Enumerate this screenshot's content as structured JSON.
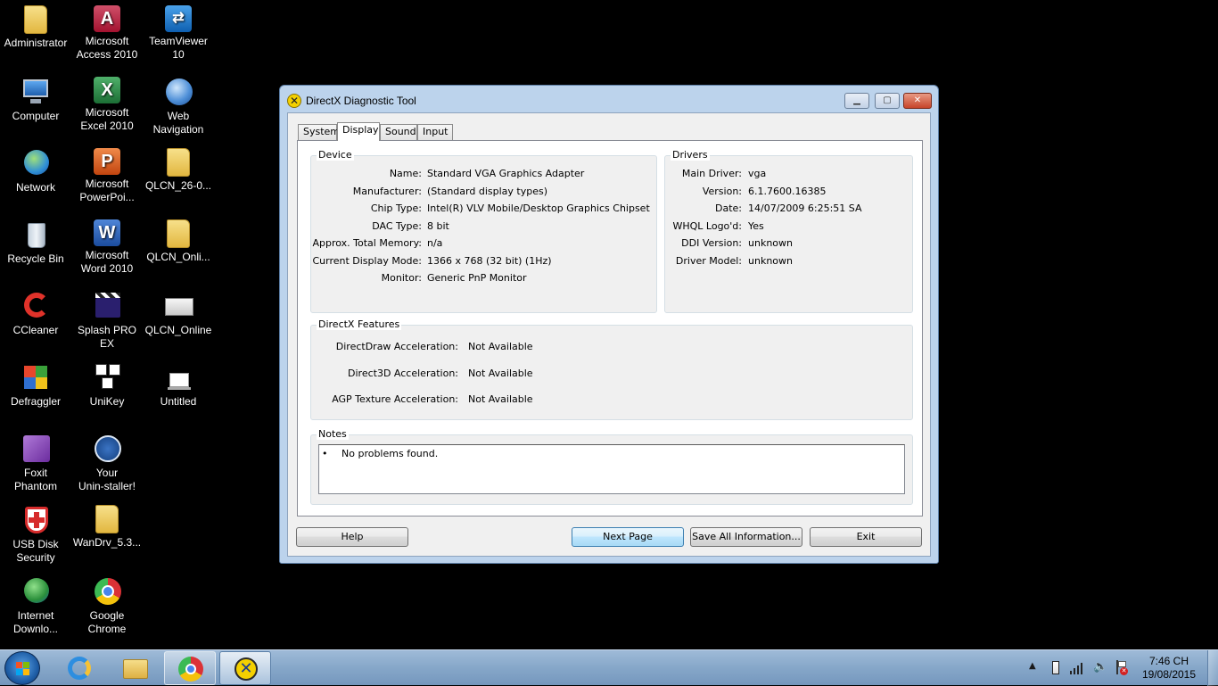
{
  "desktop_icons": [
    {
      "label": "Administrator"
    },
    {
      "label": "Computer"
    },
    {
      "label": "Network"
    },
    {
      "label": "Recycle Bin"
    },
    {
      "label": "CCleaner"
    },
    {
      "label": "Defraggler"
    },
    {
      "label": "Foxit\nPhantom"
    },
    {
      "label": "USB Disk\nSecurity"
    },
    {
      "label": "Internet\nDownlo..."
    },
    {
      "label": "Microsoft\nAccess 2010"
    },
    {
      "label": "Microsoft\nExcel 2010"
    },
    {
      "label": "Microsoft\nPowerPoi..."
    },
    {
      "label": "Microsoft\nWord 2010"
    },
    {
      "label": "Splash PRO EX"
    },
    {
      "label": "UniKey"
    },
    {
      "label": "Your\nUnin-staller!"
    },
    {
      "label": "WanDrv_5.3..."
    },
    {
      "label": "Google\nChrome"
    },
    {
      "label": "TeamViewer\n10"
    },
    {
      "label": "Web\nNavigation"
    },
    {
      "label": "QLCN_26-0..."
    },
    {
      "label": "QLCN_Onli..."
    },
    {
      "label": "QLCN_Online"
    },
    {
      "label": "Untitled"
    }
  ],
  "window": {
    "title": "DirectX Diagnostic Tool",
    "tabs": [
      "System",
      "Display",
      "Sound",
      "Input"
    ],
    "active_tab": "Display",
    "device": {
      "title": "Device",
      "rows": [
        {
          "k": "Name:",
          "v": "Standard VGA Graphics Adapter"
        },
        {
          "k": "Manufacturer:",
          "v": "(Standard display types)"
        },
        {
          "k": "Chip Type:",
          "v": "Intel(R) VLV Mobile/Desktop Graphics Chipset"
        },
        {
          "k": "DAC Type:",
          "v": "8 bit"
        },
        {
          "k": "Approx. Total Memory:",
          "v": "n/a"
        },
        {
          "k": "Current Display Mode:",
          "v": "1366 x 768 (32 bit) (1Hz)"
        },
        {
          "k": "Monitor:",
          "v": "Generic PnP Monitor"
        }
      ]
    },
    "drivers": {
      "title": "Drivers",
      "rows": [
        {
          "k": "Main Driver:",
          "v": "vga"
        },
        {
          "k": "Version:",
          "v": "6.1.7600.16385"
        },
        {
          "k": "Date:",
          "v": "14/07/2009 6:25:51 SA"
        },
        {
          "k": "WHQL Logo'd:",
          "v": "Yes"
        },
        {
          "k": "DDI Version:",
          "v": "unknown"
        },
        {
          "k": "Driver Model:",
          "v": "unknown"
        }
      ]
    },
    "features": {
      "title": "DirectX Features",
      "rows": [
        {
          "k": "DirectDraw Acceleration:",
          "v": "Not Available"
        },
        {
          "k": "Direct3D Acceleration:",
          "v": "Not Available"
        },
        {
          "k": "AGP Texture Acceleration:",
          "v": "Not Available"
        }
      ]
    },
    "notes": {
      "title": "Notes",
      "bullet": "•",
      "text": "No problems found."
    },
    "buttons": {
      "help": "Help",
      "next": "Next Page",
      "save": "Save All Information...",
      "exit": "Exit"
    }
  },
  "taskbar": {
    "time": "7:46 CH",
    "date": "19/08/2015"
  }
}
